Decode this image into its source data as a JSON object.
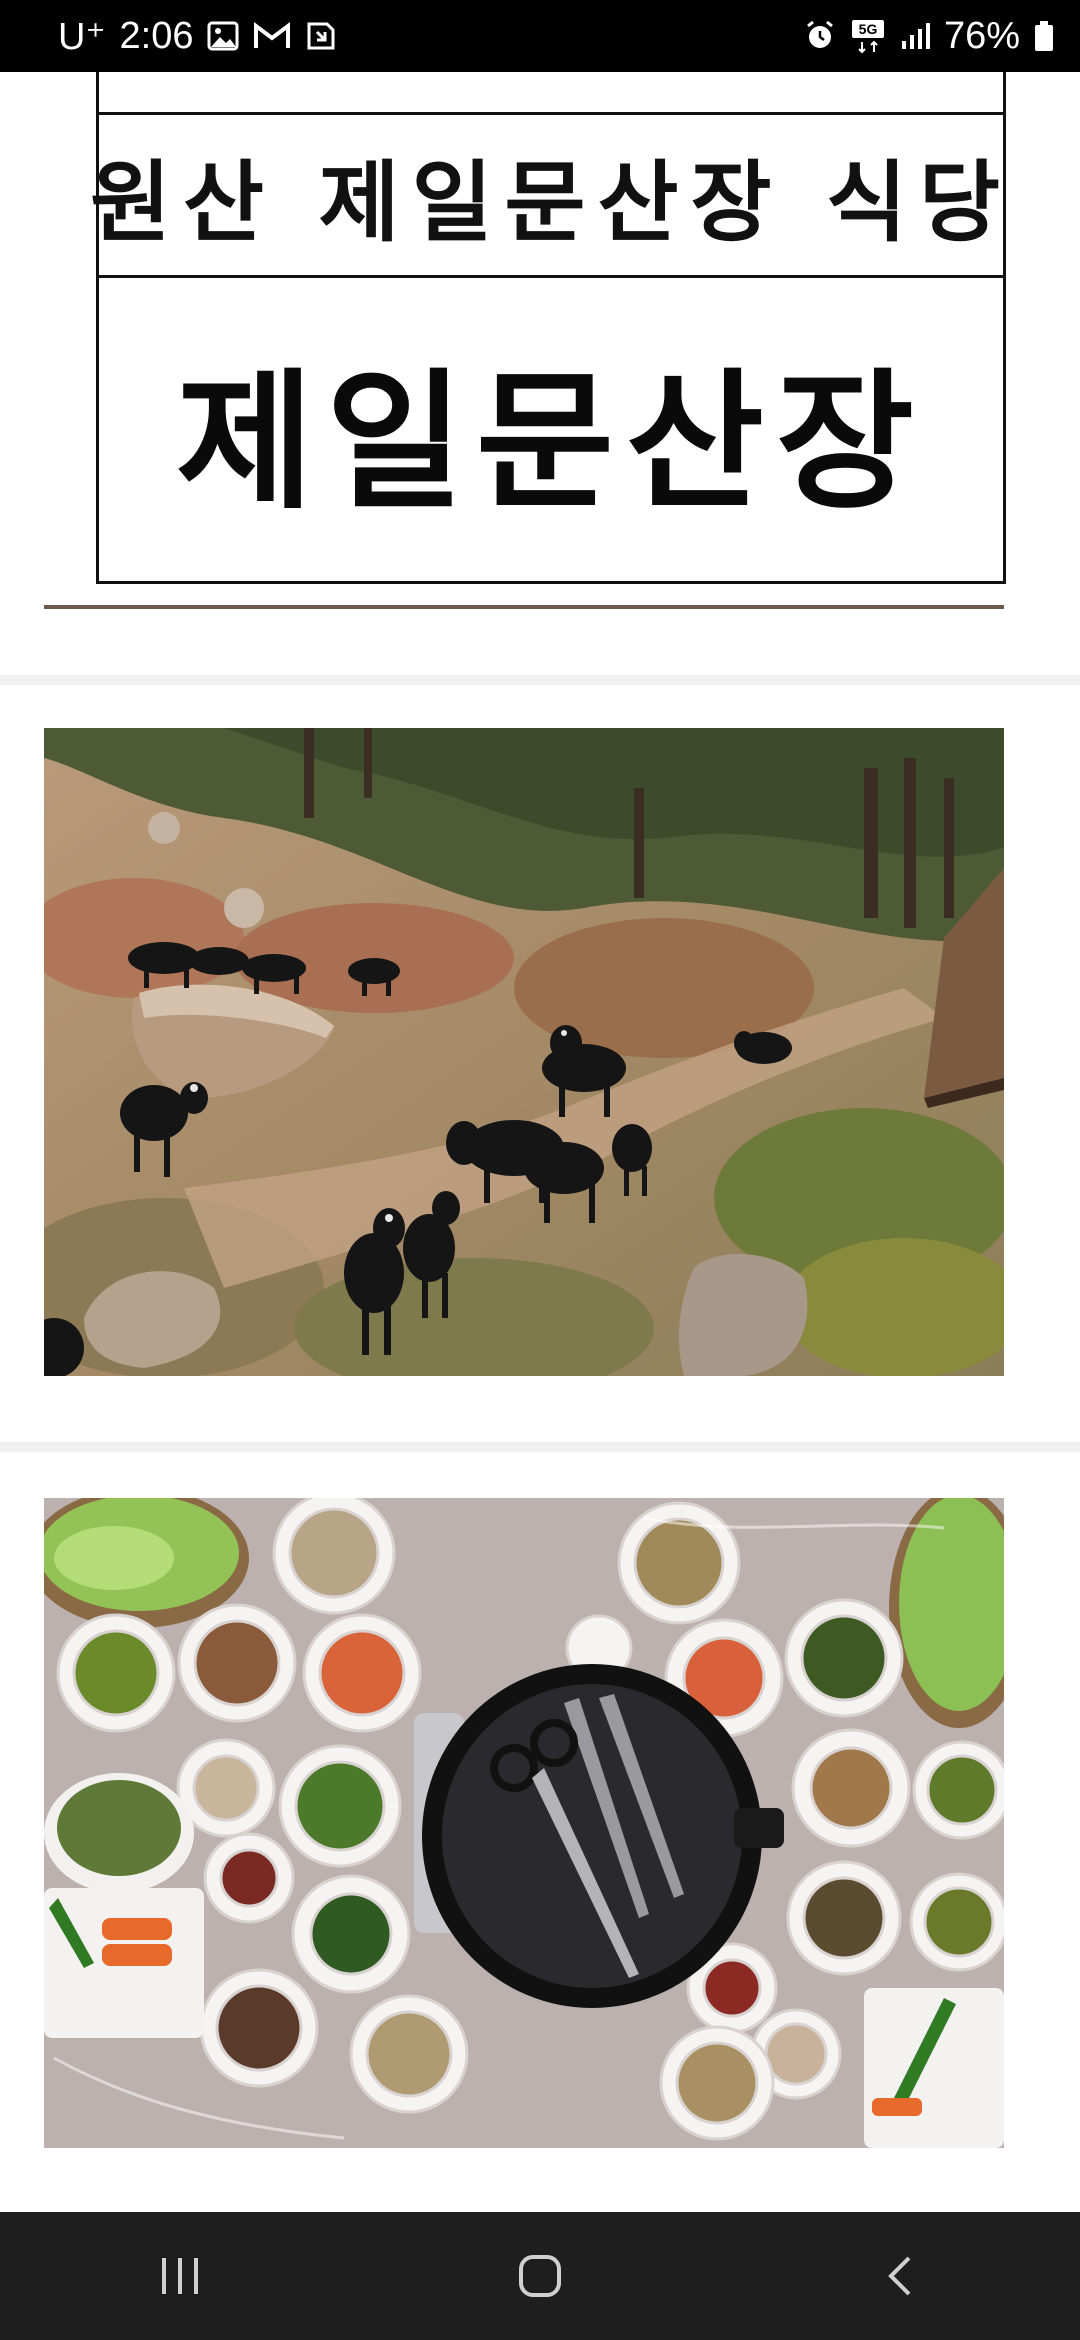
{
  "status_bar": {
    "carrier": "U⁺",
    "time": "2:06",
    "network": "5G",
    "battery": "76%"
  },
  "sign": {
    "line1": "원산 제일문산장 식당",
    "line2": "제일문산장"
  },
  "photos": [
    {
      "icon": "goats-on-hillside-photo"
    },
    {
      "icon": "korean-barbecue-table-photo"
    }
  ],
  "nav": {
    "recents": "recents-icon",
    "home": "home-icon",
    "back": "back-icon"
  }
}
